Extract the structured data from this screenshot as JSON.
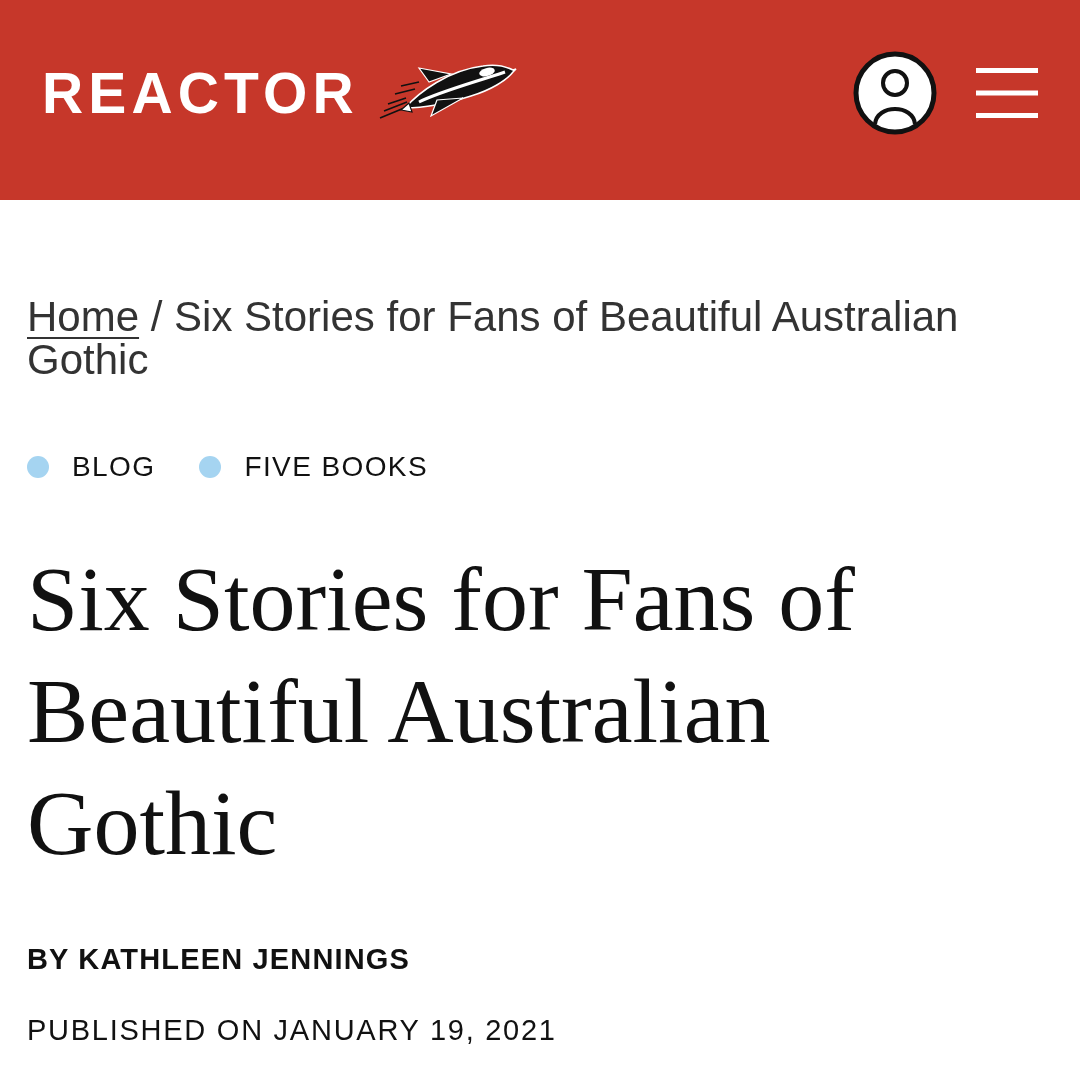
{
  "header": {
    "logo": "REACTOR"
  },
  "breadcrumb": {
    "home": "Home",
    "separator": "/",
    "current": "Six Stories for Fans of Beautiful Australian Gothic"
  },
  "categories": [
    {
      "label": "BLOG"
    },
    {
      "label": "FIVE BOOKS"
    }
  ],
  "article": {
    "title": "Six Stories for Fans of Beautiful Australian Gothic",
    "byline": "BY KATHLEEN JENNINGS",
    "published": "PUBLISHED ON JANUARY 19, 2021"
  }
}
